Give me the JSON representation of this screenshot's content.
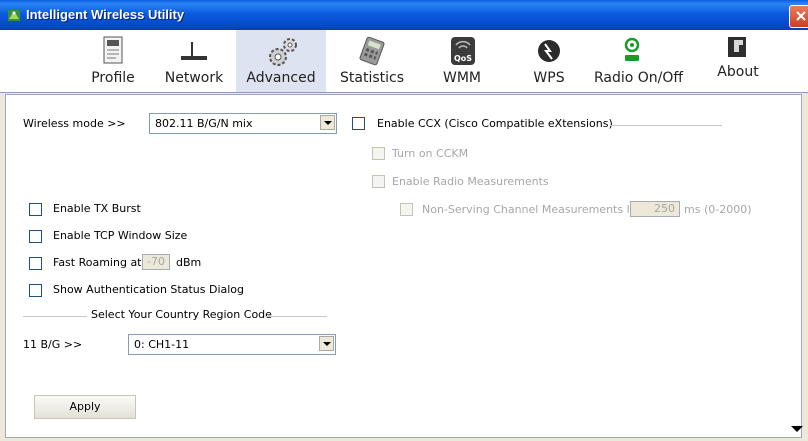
{
  "window": {
    "title": "Intelligent Wireless Utility"
  },
  "toolbar": {
    "items": [
      {
        "label": "Profile",
        "icon": "profile-icon"
      },
      {
        "label": "Network",
        "icon": "network-icon"
      },
      {
        "label": "Advanced",
        "icon": "gears-icon",
        "active": true
      },
      {
        "label": "Statistics",
        "icon": "statistics-icon"
      },
      {
        "label": "WMM",
        "icon": "qos-icon"
      },
      {
        "label": "WPS",
        "icon": "wps-icon"
      },
      {
        "label": "Radio On/Off",
        "icon": "radio-icon"
      },
      {
        "label": "About",
        "icon": "about-icon"
      }
    ]
  },
  "advanced": {
    "wireless_mode_label": "Wireless mode >>",
    "wireless_mode_value": "802.11 B/G/N mix",
    "enable_tx_burst": "Enable TX Burst",
    "enable_tcp_window": "Enable TCP Window Size",
    "fast_roaming_label": "Fast Roaming at",
    "fast_roaming_value": "-70",
    "fast_roaming_unit": "dBm",
    "show_auth_dialog": "Show Authentication Status Dialog",
    "country_region_title": "Select Your Country Region Code",
    "region_label": "11 B/G >>",
    "region_value": "0: CH1-11",
    "ccx_label": "Enable CCX (Cisco Compatible eXtensions)",
    "cckm_label": "Turn on CCKM",
    "radio_measurements_label": "Enable Radio Measurements",
    "non_serving_label": "Non-Serving Channel Measurements limit",
    "non_serving_value": "250",
    "non_serving_unit": "ms (0-2000)",
    "apply_label": "Apply"
  }
}
